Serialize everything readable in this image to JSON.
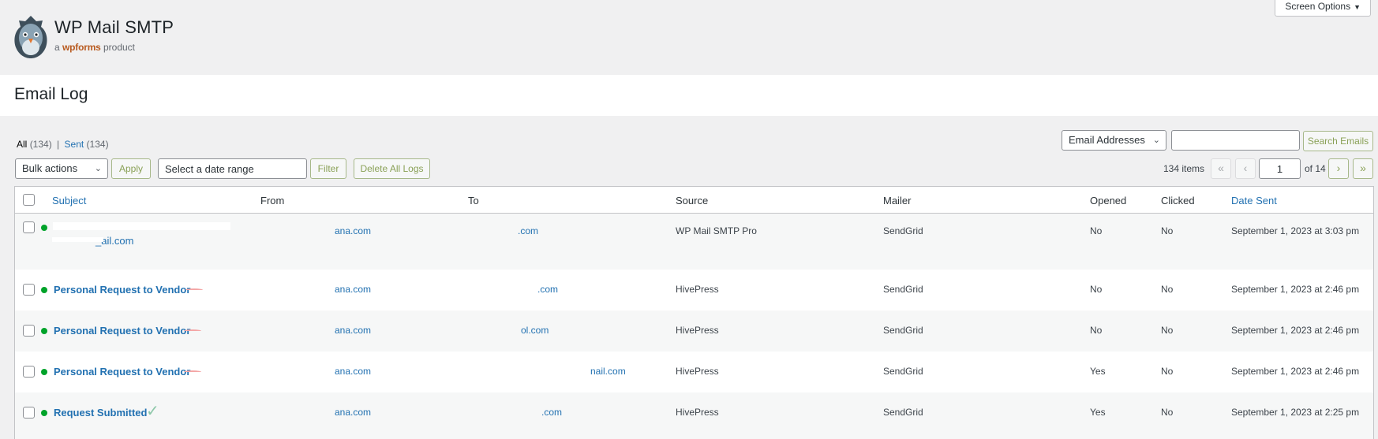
{
  "brand": {
    "title": "WP Mail SMTP",
    "sub_a": "a",
    "sub_brand": "wpforms",
    "sub_product": "product"
  },
  "screen_options": {
    "label": "Screen Options"
  },
  "page": {
    "title": "Email Log"
  },
  "views": {
    "all_label": "All",
    "all_count": "(134)",
    "sent_label": "Sent",
    "sent_count": "(134)",
    "separator": "|"
  },
  "search": {
    "type_selected": "Email Addresses",
    "input_value": "",
    "button_label": "Search Emails"
  },
  "toolbar": {
    "bulk_selected": "Bulk actions",
    "apply_label": "Apply",
    "date_placeholder": "Select a date range",
    "filter_label": "Filter",
    "delete_all_label": "Delete All Logs"
  },
  "pagination": {
    "items": "134 items",
    "first": "«",
    "prev": "‹",
    "current_page": "1",
    "of_text": "of 14",
    "next": "›",
    "last": "»"
  },
  "table": {
    "columns": [
      "Subject",
      "From",
      "To",
      "Source",
      "Mailer",
      "Opened",
      "Clicked",
      "Date Sent"
    ],
    "rows": [
      {
        "subject_tail": "_ail.com",
        "from": "ana.com",
        "to": ".com",
        "source": "WP Mail SMTP Pro",
        "mailer": "SendGrid",
        "opened": "No",
        "clicked": "No",
        "date": "September 1, 2023 at 3:03 pm"
      },
      {
        "subject": "Personal Request to Vendor",
        "from": "ana.com",
        "to": ".com",
        "source": "HivePress",
        "mailer": "SendGrid",
        "opened": "No",
        "clicked": "No",
        "date": "September 1, 2023 at 2:46 pm"
      },
      {
        "subject": "Personal Request to Vendor",
        "from": "ana.com",
        "to": "ol.com",
        "source": "HivePress",
        "mailer": "SendGrid",
        "opened": "No",
        "clicked": "No",
        "date": "September 1, 2023 at 2:46 pm"
      },
      {
        "subject": "Personal Request to Vendor",
        "from": "ana.com",
        "to": "nail.com",
        "source": "HivePress",
        "mailer": "SendGrid",
        "opened": "Yes",
        "clicked": "No",
        "date": "September 1, 2023 at 2:46 pm"
      },
      {
        "subject": "Request Submitted",
        "from": "ana.com",
        "to": ".com",
        "source": "HivePress",
        "mailer": "SendGrid",
        "opened": "Yes",
        "clicked": "No",
        "date": "September 1, 2023 at 2:25 pm"
      }
    ]
  },
  "colors": {
    "accent": "#2271b1",
    "status_sent": "#00a32a",
    "button_green": "#8aa157"
  }
}
